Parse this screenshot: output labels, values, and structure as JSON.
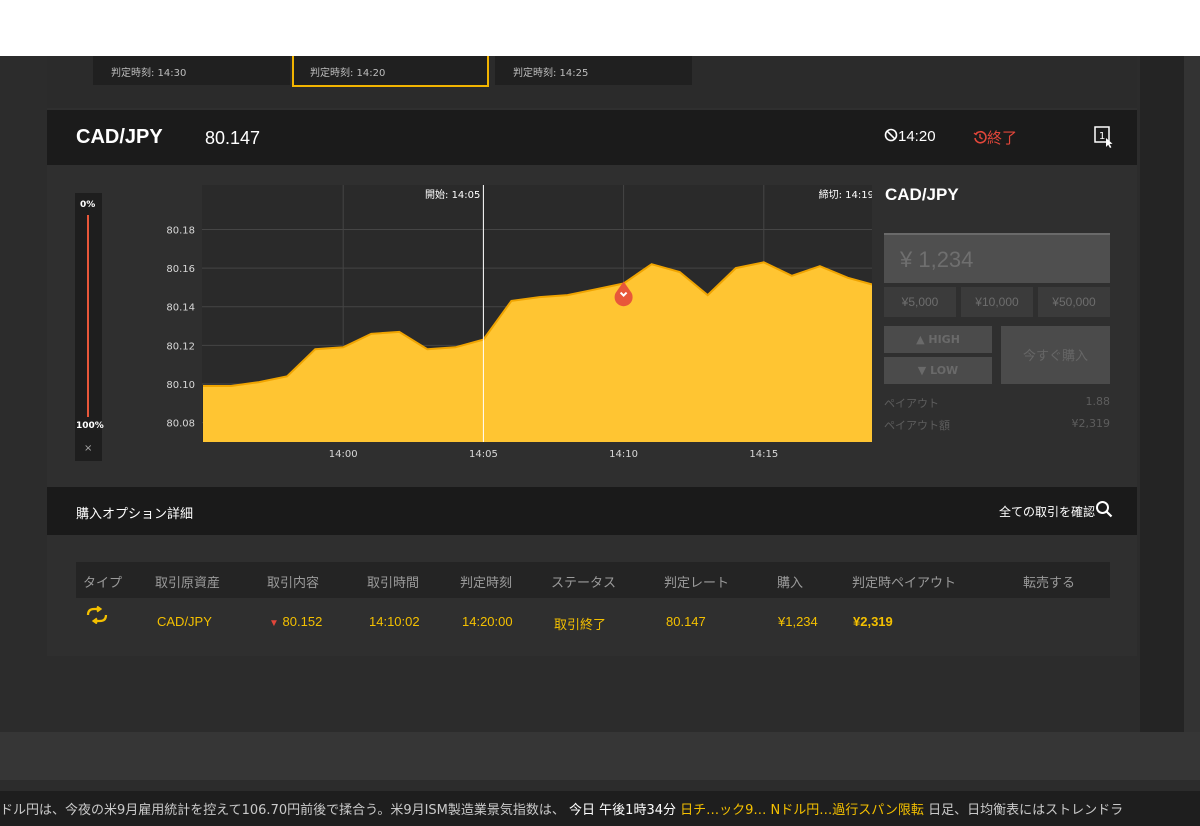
{
  "tabs": [
    {
      "label": "判定時刻: 14:30"
    },
    {
      "label": "判定時刻: 14:20"
    },
    {
      "label": "判定時刻: 14:25"
    }
  ],
  "header": {
    "pair": "CAD/JPY",
    "rate": "80.147",
    "deadline": "14:20",
    "status": "終了",
    "deadline_icon": "no-entry-icon",
    "status_icon": "clock-history-icon",
    "screen_icon": "screen-1-cursor-icon"
  },
  "gauge": {
    "top": "0%",
    "bottom": "100%",
    "close": "×"
  },
  "chart_data": {
    "type": "area",
    "x": [
      "13:55",
      "13:56",
      "13:57",
      "13:58",
      "13:59",
      "14:00",
      "14:01",
      "14:02",
      "14:03",
      "14:04",
      "14:05",
      "14:06",
      "14:07",
      "14:08",
      "14:09",
      "14:10",
      "14:11",
      "14:12",
      "14:13",
      "14:14",
      "14:15",
      "14:16",
      "14:17",
      "14:18",
      "14:19",
      "14:20"
    ],
    "values": [
      80.099,
      80.099,
      80.101,
      80.104,
      80.118,
      80.119,
      80.126,
      80.127,
      80.118,
      80.119,
      80.123,
      80.143,
      80.145,
      80.146,
      80.149,
      80.152,
      80.162,
      80.158,
      80.146,
      80.16,
      80.163,
      80.156,
      80.161,
      80.155,
      80.151,
      80.147
    ],
    "xticks": [
      "14:00",
      "14:05",
      "14:10",
      "14:15"
    ],
    "yticks": [
      "80.18",
      "80.16",
      "80.14",
      "80.12",
      "80.10",
      "80.08"
    ],
    "ylim": [
      80.07,
      80.203
    ],
    "start_label": "開始: 14:05",
    "cutoff_label": "締切: 14:19",
    "entry_value": 80.152,
    "fill_color": "#ffc532",
    "line_color": "#f0a400",
    "grid": true
  },
  "side": {
    "pair": "CAD/JPY",
    "amount": "¥ 1,234",
    "quick": [
      "¥5,000",
      "¥10,000",
      "¥50,000"
    ],
    "high": "HIGH",
    "low": "LOW",
    "buy_now": "今すぐ購入",
    "payout_label": "ペイアウト",
    "payout_value": "1.88",
    "payout_amount_label": "ペイアウト額",
    "payout_amount_value": "¥2,319"
  },
  "options": {
    "title": "購入オプション詳細",
    "link": "全ての取引を確認",
    "columns": [
      "タイプ",
      "取引原資産",
      "取引内容",
      "取引時間",
      "判定時刻",
      "ステータス",
      "判定レート",
      "購入",
      "判定時ペイアウト",
      "転売する"
    ],
    "row": {
      "type_icon": "type-swap-icon",
      "asset": "CAD/JPY",
      "direction_icon": "down-arrow-icon",
      "content": "80.152",
      "time": "14:10:02",
      "judge_time": "14:20:00",
      "status": "取引終了",
      "judge_rate": "80.147",
      "purchase": "¥1,234",
      "payout": "¥2,319"
    }
  },
  "ticker": {
    "part1": "ドル円は、今夜の米9月雇用統計を控えて106.70円前後で揉合う。米9月ISM製造業景気指数は、",
    "part2": "今日 午後1時34分",
    "part3": "日チ…ック9… Nドル円…過行スパン限転",
    "part4": "日足、日均衡表にはストレンドラ"
  },
  "colors": {
    "accent": "#f4c000",
    "danger": "#e2463a",
    "header_bg": "#1b1b1b"
  }
}
